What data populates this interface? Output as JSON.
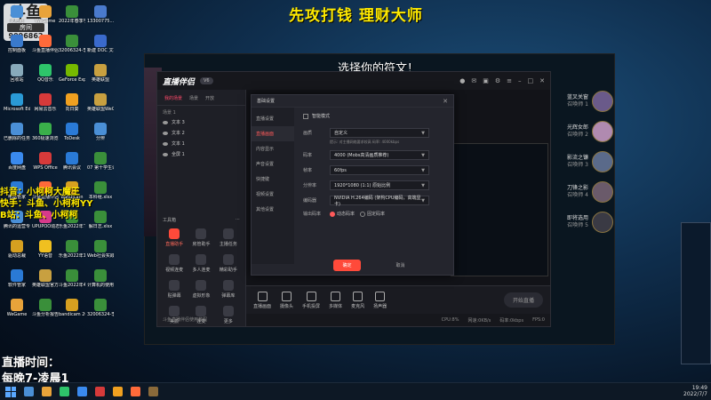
{
  "overlay": {
    "platform_logo": "斗鱼",
    "room_label": "房间",
    "room_number": "9096862",
    "top_banner": "先攻打钱 理财大师",
    "choose_title": "选择你的符文！",
    "promo_lines": [
      "抖音：小柯柯大魔王",
      "快手：斗鱼、小柯柯YY",
      "B站：斗鱼、小柯柯"
    ],
    "live_time_label": "直播时间：",
    "live_time_value": "每晚7-凌晨1"
  },
  "desktop_icons": [
    {
      "label": "此电脑",
      "color": "#4a8fd6"
    },
    {
      "label": "WeGame",
      "color": "#e8a33a"
    },
    {
      "label": "2022年春季学期",
      "color": "#3a8f3a"
    },
    {
      "label": "13300775...",
      "color": "#4a7acc"
    },
    {
      "label": "控制面板",
      "color": "#3a7acc"
    },
    {
      "label": "斗鱼直播伴侣",
      "color": "#ff6a3a"
    },
    {
      "label": "32006324-李鸿川",
      "color": "#3a8f3a"
    },
    {
      "label": "新建 DOC 文档",
      "color": "#3a6acc"
    },
    {
      "label": "回收站",
      "color": "#8ab"
    },
    {
      "label": "QQ音乐",
      "color": "#2ec46a"
    },
    {
      "label": "GeForce Experience",
      "color": "#76b900"
    },
    {
      "label": "英雄联盟",
      "color": "#c8a040"
    },
    {
      "label": "Microsoft Edge",
      "color": "#2a9ad6"
    },
    {
      "label": "网易云音乐",
      "color": "#d63a3a"
    },
    {
      "label": "向日葵",
      "color": "#f0a020"
    },
    {
      "label": "英雄联盟WeGame版",
      "color": "#c8a040"
    },
    {
      "label": "已删除的任务",
      "color": "#4a8fd6"
    },
    {
      "label": "360极速浏览器",
      "color": "#3ab04a"
    },
    {
      "label": "ToDesk",
      "color": "#2a7ad6"
    },
    {
      "label": "分辨",
      "color": "#4a8fd6"
    },
    {
      "label": "百度网盘",
      "color": "#3a8aee"
    },
    {
      "label": "WPS Office",
      "color": "#d63a3a"
    },
    {
      "label": "腾讯会议",
      "color": "#2a7ad6"
    },
    {
      "label": "07 第十学生课程计划",
      "color": "#3a8f3a"
    },
    {
      "label": "电脑管家",
      "color": "#2a7ad6"
    },
    {
      "label": "斗鱼直播伴侣",
      "color": "#ff6a3a"
    },
    {
      "label": "Bandicam",
      "color": "#d6a020"
    },
    {
      "label": "本科组.xlsx",
      "color": "#3a8f3a"
    },
    {
      "label": "腾讯的运营专业",
      "color": "#4a8fd6"
    },
    {
      "label": "UPUPOO动态桌面",
      "color": "#d63a8a"
    },
    {
      "label": "乐鱼2022年下半年课表",
      "color": "#3a8f3a"
    },
    {
      "label": "解日志.xlsx",
      "color": "#3a8f3a"
    },
    {
      "label": "驱动总裁",
      "color": "#d6a020"
    },
    {
      "label": "YY语音",
      "color": "#f0c020"
    },
    {
      "label": "乐鱼2022年1-3月直播",
      "color": "#3a8f3a"
    },
    {
      "label": "Web社会实践-正式版",
      "color": "#3a8f3a"
    },
    {
      "label": "软件管家",
      "color": "#2a7ad6"
    },
    {
      "label": "英雄联盟官方素材",
      "color": "#c8a040"
    },
    {
      "label": "斗鱼2022年4-6月直播",
      "color": "#3a8f3a"
    },
    {
      "label": "计算机的使用管理",
      "color": "#3a8f3a"
    },
    {
      "label": "WeGame",
      "color": "#e8a33a"
    },
    {
      "label": "斗鱼分析报告",
      "color": "#3a8f3a"
    },
    {
      "label": "bandicam 2022-06-2...",
      "color": "#d6a020"
    },
    {
      "label": "32006324-李鸿川",
      "color": "#3a8f3a"
    }
  ],
  "champions": [
    {
      "name": "蓝叉关窗",
      "sub": "召唤师 1",
      "color": "#6a5a8a"
    },
    {
      "name": "光辉女郎",
      "sub": "召唤师 2",
      "color": "#b08ab0"
    },
    {
      "name": "影流之镰",
      "sub": "召唤师 3",
      "color": "#5a6a8a"
    },
    {
      "name": "刀锋之影",
      "sub": "召唤师 4",
      "color": "#6a5a6a"
    },
    {
      "name": "即将选用",
      "sub": "召唤师 5",
      "color": "#3a3a44"
    }
  ],
  "app": {
    "logo": "直播伴侣",
    "version": "V6",
    "scene_tabs": [
      "我的场景",
      "场景",
      "开放"
    ],
    "scene_header": "场景 1",
    "sources": [
      "文本 3",
      "文本 2",
      "文本 1",
      "全屏 1"
    ],
    "tools_label": "工具箱",
    "tools": [
      {
        "label": "直播助手",
        "hot": true
      },
      {
        "label": "房管助手",
        "hot": false
      },
      {
        "label": "主播任务",
        "hot": false
      },
      {
        "label": "视频连麦",
        "hot": false
      },
      {
        "label": "多人连麦",
        "hot": false
      },
      {
        "label": "精彩助手",
        "hot": false
      },
      {
        "label": "贴弹幕",
        "hot": false
      },
      {
        "label": "虚拟形象",
        "hot": false
      },
      {
        "label": "弹幕库",
        "hot": false
      },
      {
        "label": "美颜",
        "hot": false
      },
      {
        "label": "连麦",
        "hot": false
      },
      {
        "label": "更多",
        "hot": false
      }
    ],
    "footer_note": "斗鱼直播伴侣使用教程",
    "bottom_toolbar": [
      {
        "label": "直播画面"
      },
      {
        "label": "摄像头"
      },
      {
        "label": "手机投屏"
      },
      {
        "label": "多媒体"
      },
      {
        "label": "麦克风"
      },
      {
        "label": "扬声器"
      }
    ],
    "start_live": "开始直播",
    "status": [
      "CPU:8%",
      "网速:0KB/s",
      "码率:0kbps",
      "FPS:0"
    ]
  },
  "dialog": {
    "title": "基础设置",
    "nav": [
      "直播设置",
      "直播画面",
      "内容显示",
      "声音设置",
      "快捷键",
      "视频设置",
      "其他设置"
    ],
    "active_nav": "直播画面",
    "checkbox_label": "智能模式",
    "fields": [
      {
        "label": "画质",
        "value": "自定义"
      },
      {
        "label": "码率",
        "value": "4000 (Mobs高清画质推荐)"
      },
      {
        "label": "帧率",
        "value": "60fps"
      },
      {
        "label": "分辨率",
        "value": "1920*1080 (1:1) 原始比例"
      },
      {
        "label": "编码器",
        "value": "NVIDIA H.264编码 (架构CPU编码，高端显卡)"
      }
    ],
    "note": "提示: 对主播网络要求较高 码率: 4000kbps",
    "output_label": "输出码率",
    "output_options": [
      "动态码率",
      "固定码率"
    ],
    "output_selected": "动态码率",
    "confirm": "确定",
    "cancel": "取消"
  },
  "taskbar": {
    "time": "19:49",
    "date": "2022/7/7",
    "icon_colors": [
      "#4a8fd6",
      "#e8a33a",
      "#2ec46a",
      "#3a8aee",
      "#d63a3a",
      "#f0a020",
      "#ff6a3a",
      "#8a6a3a"
    ]
  }
}
